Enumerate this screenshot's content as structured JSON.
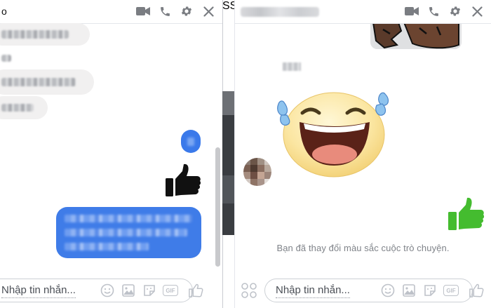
{
  "left_chat": {
    "title_visible": "o",
    "header_icons": [
      "video-call-icon",
      "phone-icon",
      "gear-icon",
      "close-icon"
    ],
    "composer_placeholder": "Nhập tin nhắn...",
    "composer_icons": [
      "emoji-icon",
      "photo-icon",
      "sticker-icon",
      "gif-icon",
      "like-icon"
    ],
    "gif_label": "GIF"
  },
  "separator_text": "SS",
  "right_chat": {
    "header_icons": [
      "video-call-icon",
      "phone-icon",
      "gear-icon",
      "close-icon"
    ],
    "system_message": "Bạn đã thay đổi màu sắc cuộc trò chuyện.",
    "composer_placeholder": "Nhập tin nhắn...",
    "composer_icons": [
      "apps-icon",
      "emoji-icon",
      "photo-icon",
      "sticker-icon",
      "gif-icon",
      "like-icon"
    ],
    "gif_label": "GIF"
  },
  "colors": {
    "left_accent": "#3f7ce8",
    "right_accent": "#44bc2f",
    "icon_gray": "#bec2c9",
    "header_icon": "#7a7d82"
  }
}
